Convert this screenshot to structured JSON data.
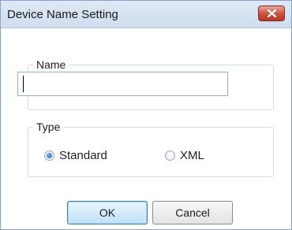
{
  "window": {
    "title": "Device Name Setting"
  },
  "name_group": {
    "legend": "Name",
    "input_value": ""
  },
  "type_group": {
    "legend": "Type",
    "options": [
      {
        "label": "Standard",
        "selected": true
      },
      {
        "label": "XML",
        "selected": false
      }
    ]
  },
  "buttons": {
    "ok_label": "OK",
    "cancel_label": "Cancel"
  },
  "icons": {
    "close": "close-icon"
  }
}
